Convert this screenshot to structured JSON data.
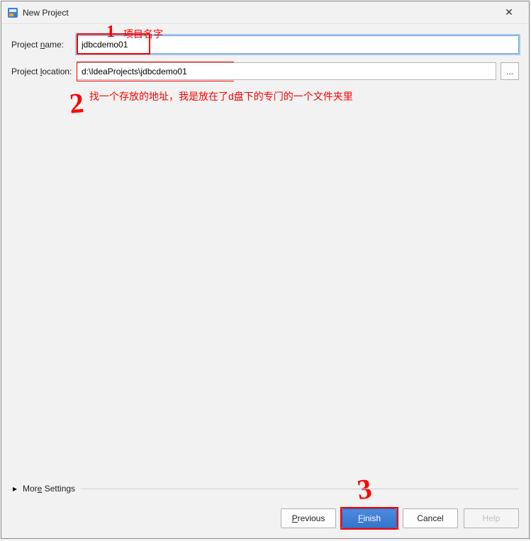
{
  "titlebar": {
    "title": "New Project",
    "close_glyph": "✕"
  },
  "form": {
    "name_label_pre": "Project ",
    "name_label_mnemonic": "n",
    "name_label_post": "ame:",
    "name_value": "jdbcdemo01",
    "location_label_pre": "Project ",
    "location_label_mnemonic": "l",
    "location_label_post": "ocation:",
    "location_value": "d:\\IdeaProjects\\jdbcdemo01",
    "browse_label": "..."
  },
  "more_settings": {
    "expand_glyph": "▸",
    "label_pre": "Mor",
    "label_mnemonic": "e",
    "label_post": " Settings"
  },
  "buttons": {
    "previous_pre": "",
    "previous_mnemonic": "P",
    "previous_post": "revious",
    "finish_pre": "",
    "finish_mnemonic": "F",
    "finish_post": "inish",
    "cancel_label": "Cancel",
    "help_label": "Help"
  },
  "annotations": {
    "mark1": "1",
    "text1": "项目名字",
    "mark2": "2",
    "text2": "找一个存放的地址，我是放在了d盘下的专门的一个文件夹里",
    "mark3": "3"
  }
}
